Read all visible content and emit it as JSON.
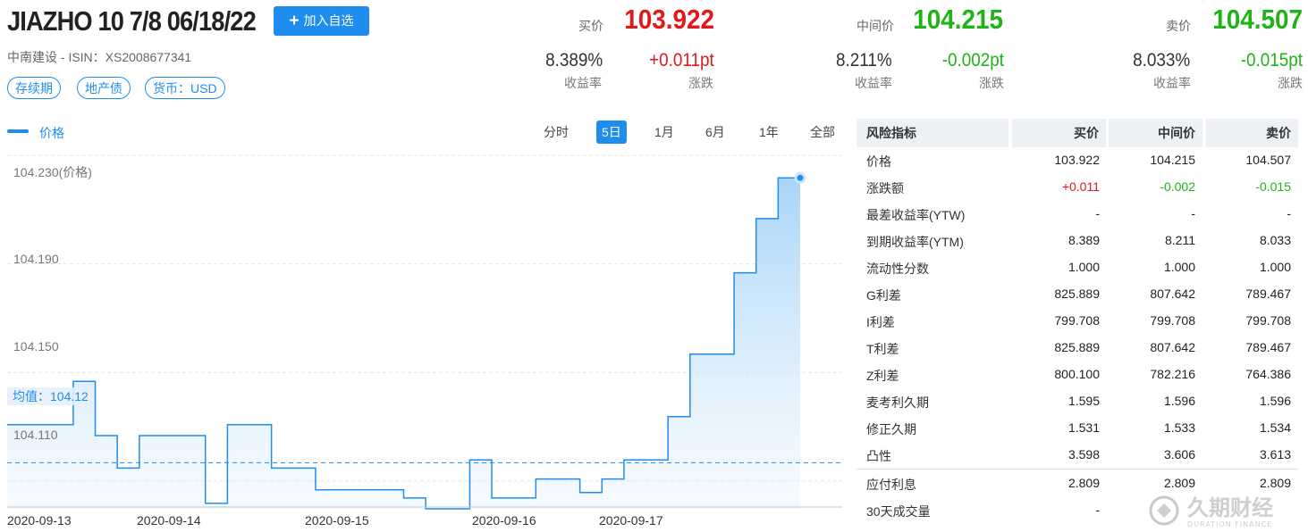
{
  "header": {
    "title": "JIAZHO 10 7/8 06/18/22",
    "add_button_label": "加入自选",
    "subtitle": "中南建设 - ISIN：XS2008677341",
    "tags": [
      "存续期",
      "地产债",
      "货币：USD"
    ]
  },
  "quotes": {
    "bid": {
      "label": "买价",
      "price": "103.922",
      "yield": "8.389%",
      "yield_label": "收益率",
      "change": "+0.011pt",
      "change_label": "涨跌"
    },
    "mid": {
      "label": "中间价",
      "price": "104.215",
      "yield": "8.211%",
      "yield_label": "收益率",
      "change": "-0.002pt",
      "change_label": "涨跌"
    },
    "ask": {
      "label": "卖价",
      "price": "104.507",
      "yield": "8.033%",
      "yield_label": "收益率",
      "change": "-0.015pt",
      "change_label": "涨跌"
    }
  },
  "chart": {
    "legend": "价格",
    "ranges": [
      "分时",
      "5日",
      "1月",
      "6月",
      "1年",
      "全部"
    ],
    "active_range": "5日",
    "y_tick_labels": [
      "104.230(价格)",
      "104.190",
      "104.150",
      "104.110"
    ],
    "x_tick_labels": [
      "2020-09-13",
      "2020-09-14",
      "2020-09-15",
      "2020-09-16",
      "2020-09-17"
    ],
    "average_label": "均值：104.12"
  },
  "chart_data": {
    "type": "line",
    "title": "",
    "xlabel": "",
    "ylabel": "",
    "ylim": [
      104.103,
      104.233
    ],
    "x": [
      "2020-09-13",
      "2020-09-14",
      "2020-09-15",
      "2020-09-16",
      "2020-09-17"
    ],
    "average": 104.12,
    "grid": true,
    "series": [
      {
        "name": "价格",
        "color": "#1f8ded",
        "values": [
          104.134,
          104.134,
          104.134,
          104.15,
          104.13,
          104.118,
          104.13,
          104.13,
          104.13,
          104.105,
          104.134,
          104.134,
          104.118,
          104.118,
          104.11,
          104.11,
          104.11,
          104.11,
          104.107,
          104.103,
          104.103,
          104.121,
          104.107,
          104.107,
          104.114,
          104.114,
          104.109,
          104.114,
          104.121,
          104.121,
          104.137,
          104.16,
          104.16,
          104.19,
          104.21,
          104.225,
          104.225
        ]
      }
    ]
  },
  "risk_table": {
    "headers": [
      "风险指标",
      "买价",
      "中间价",
      "卖价"
    ],
    "rows": [
      {
        "label": "价格",
        "values": [
          "103.922",
          "104.215",
          "104.507"
        ]
      },
      {
        "label": "涨跌额",
        "values": [
          "+0.011",
          "-0.002",
          "-0.015"
        ]
      },
      {
        "label": "最差收益率(YTW)",
        "values": [
          "-",
          "-",
          "-"
        ]
      },
      {
        "label": "到期收益率(YTM)",
        "values": [
          "8.389",
          "8.211",
          "8.033"
        ]
      },
      {
        "label": "流动性分数",
        "values": [
          "1.000",
          "1.000",
          "1.000"
        ]
      },
      {
        "label": "G利差",
        "values": [
          "825.889",
          "807.642",
          "789.467"
        ]
      },
      {
        "label": "I利差",
        "values": [
          "799.708",
          "799.708",
          "799.708"
        ]
      },
      {
        "label": "T利差",
        "values": [
          "825.889",
          "807.642",
          "789.467"
        ]
      },
      {
        "label": "Z利差",
        "values": [
          "800.100",
          "782.216",
          "764.386"
        ]
      },
      {
        "label": "麦考利久期",
        "values": [
          "1.595",
          "1.596",
          "1.596"
        ]
      },
      {
        "label": "修正久期",
        "values": [
          "1.531",
          "1.533",
          "1.534"
        ]
      },
      {
        "label": "凸性",
        "values": [
          "3.598",
          "3.606",
          "3.613"
        ]
      }
    ],
    "extra_rows": [
      {
        "label": "应付利息",
        "values": [
          "2.809",
          "2.809",
          "2.809"
        ]
      },
      {
        "label": "30天成交量",
        "values": [
          "-",
          "",
          ""
        ]
      }
    ]
  },
  "watermark": {
    "brand": "久期财经",
    "brand_en": "DURATION FINANCE"
  },
  "colors": {
    "accent": "#1f8ded",
    "up": "#e0191b",
    "down": "#1fb318"
  }
}
